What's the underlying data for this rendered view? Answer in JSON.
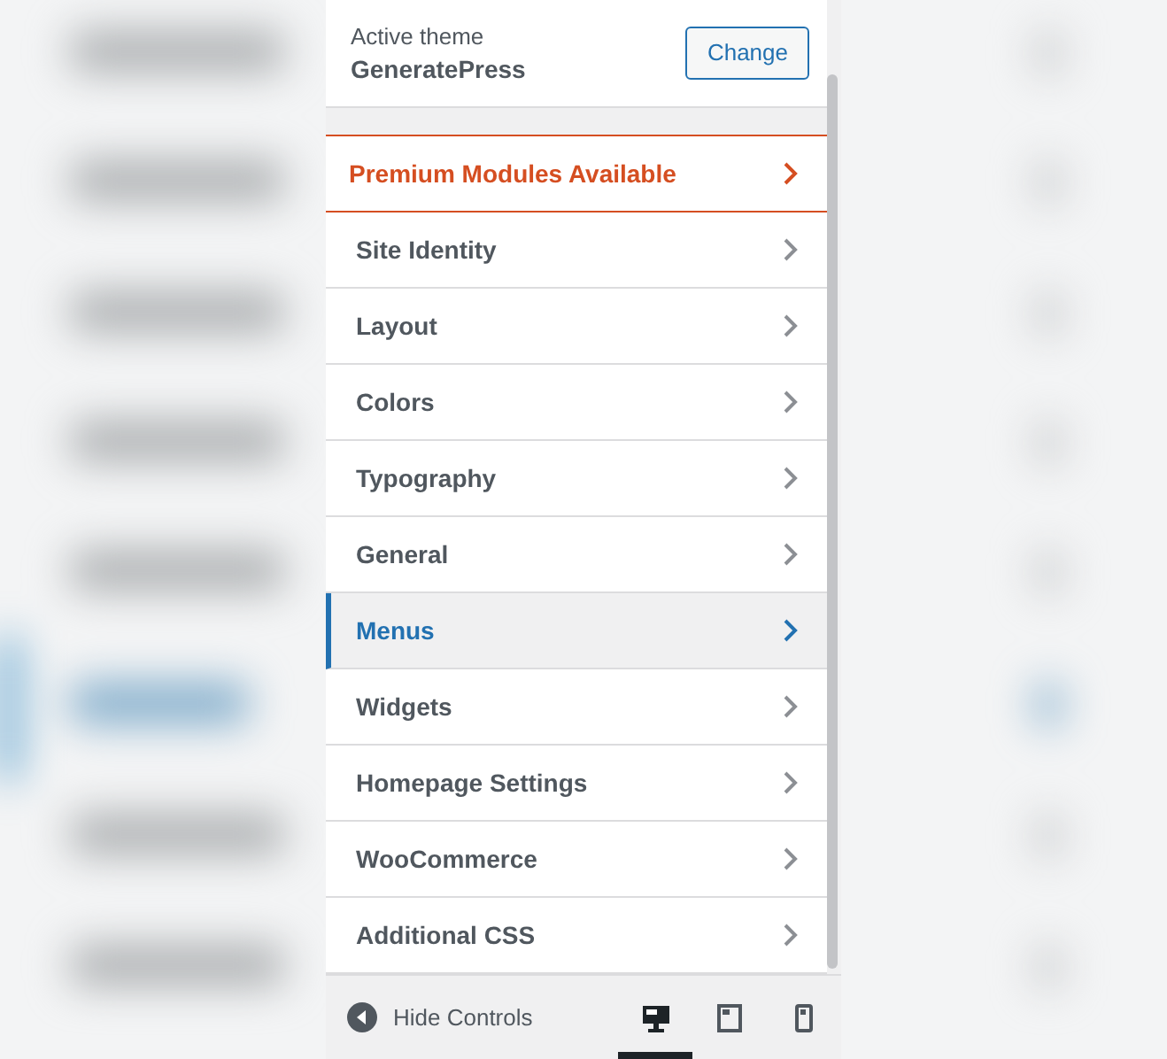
{
  "theme": {
    "label": "Active theme",
    "name": "GeneratePress",
    "button": "Change"
  },
  "sections": [
    {
      "label": "Premium Modules Available",
      "kind": "premium",
      "selected": false
    },
    {
      "label": "Site Identity",
      "kind": "section",
      "selected": false
    },
    {
      "label": "Layout",
      "kind": "section",
      "selected": false
    },
    {
      "label": "Colors",
      "kind": "section",
      "selected": false
    },
    {
      "label": "Typography",
      "kind": "section",
      "selected": false
    },
    {
      "label": "General",
      "kind": "section",
      "selected": false
    },
    {
      "label": "Menus",
      "kind": "section",
      "selected": true
    },
    {
      "label": "Widgets",
      "kind": "section",
      "selected": false
    },
    {
      "label": "Homepage Settings",
      "kind": "section",
      "selected": false
    },
    {
      "label": "WooCommerce",
      "kind": "section",
      "selected": false
    },
    {
      "label": "Additional CSS",
      "kind": "section",
      "selected": false
    }
  ],
  "footer": {
    "hide_controls": "Hide Controls",
    "devices": [
      {
        "kind": "desktop",
        "selected": true
      },
      {
        "kind": "tablet",
        "selected": false
      },
      {
        "kind": "mobile",
        "selected": false
      }
    ]
  }
}
